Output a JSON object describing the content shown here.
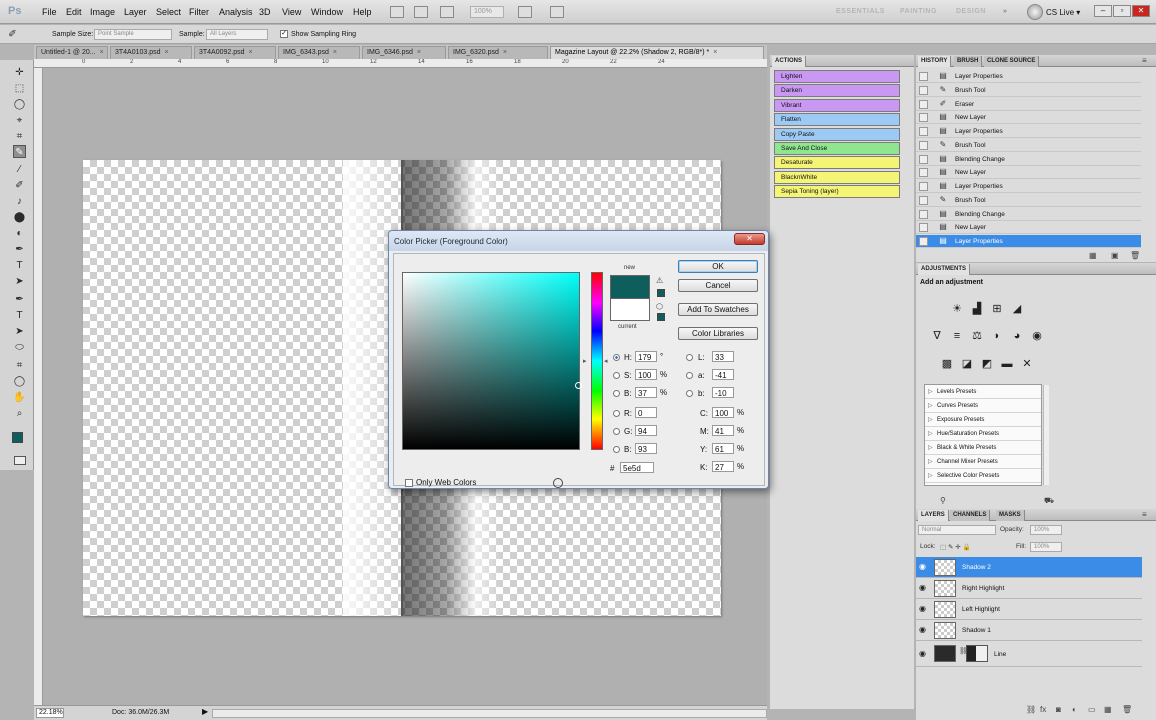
{
  "app": {
    "logo": "Ps"
  },
  "menu": [
    "File",
    "Edit",
    "Image",
    "Layer",
    "Select",
    "Filter",
    "Analysis",
    "3D",
    "View",
    "Window",
    "Help"
  ],
  "menubar_zoom": "100%",
  "workspaces": [
    "ESSENTIALS",
    "PAINTING",
    "DESIGN",
    "»"
  ],
  "cs_live": "CS Live ▾",
  "window_buttons": {
    "minimize": "–",
    "restore": "▫",
    "close": "✕"
  },
  "options": {
    "sample_size_label": "Sample Size:",
    "sample_size_value": "Point Sample",
    "sample_label": "Sample:",
    "sample_value": "All Layers",
    "show_ring_label": "Show Sampling Ring",
    "show_ring_checked": "✓"
  },
  "tabs": [
    {
      "label": "Untitled-1 @ 20..."
    },
    {
      "label": "3T4A0103.psd"
    },
    {
      "label": "3T4A0092.psd"
    },
    {
      "label": "IMG_6343.psd"
    },
    {
      "label": "IMG_6346.psd"
    },
    {
      "label": "IMG_6320.psd"
    },
    {
      "label": "Magazine Layout @ 22.2% (Shadow 2, RGB/8*) *"
    }
  ],
  "tab_close": "×",
  "ruler_numbers": [
    "0",
    "2",
    "4",
    "6",
    "8",
    "10",
    "12",
    "14",
    "16",
    "18",
    "20",
    "22",
    "24"
  ],
  "tools": [
    "✛",
    "⬚",
    "◯",
    "⌖",
    "⌗",
    "✎",
    "⁄",
    "✐",
    "♪",
    "⬤",
    "◐",
    "✒",
    "T",
    "➤",
    "⬭",
    "✋",
    "⌕"
  ],
  "status": {
    "zoom": "22.18%",
    "doc": "Doc: 36.0M/26.3M",
    "arrow": "▶"
  },
  "actions": {
    "title": "ACTIONS",
    "items": [
      {
        "label": "Lighten",
        "color": "#c898f2"
      },
      {
        "label": "Darken",
        "color": "#c898f2"
      },
      {
        "label": "Vibrant",
        "color": "#c898f2"
      },
      {
        "label": "Flatten",
        "color": "#9ccaf5"
      },
      {
        "label": "Copy Paste",
        "color": "#9ccaf5"
      },
      {
        "label": "Save And Close",
        "color": "#8fe68f"
      },
      {
        "label": "Desaturate",
        "color": "#f5f575"
      },
      {
        "label": "BlacknWhite",
        "color": "#f5f575"
      },
      {
        "label": "Sepia Toning (layer)",
        "color": "#f5f575"
      }
    ]
  },
  "history": {
    "tabs": [
      "HISTORY",
      "BRUSH",
      "CLONE SOURCE"
    ],
    "items": [
      {
        "label": "Layer Properties",
        "icon": "▤"
      },
      {
        "label": "Brush Tool",
        "icon": "✎"
      },
      {
        "label": "Eraser",
        "icon": "✐"
      },
      {
        "label": "New Layer",
        "icon": "▤"
      },
      {
        "label": "Layer Properties",
        "icon": "▤"
      },
      {
        "label": "Brush Tool",
        "icon": "✎"
      },
      {
        "label": "Blending Change",
        "icon": "▤"
      },
      {
        "label": "New Layer",
        "icon": "▤"
      },
      {
        "label": "Layer Properties",
        "icon": "▤"
      },
      {
        "label": "Brush Tool",
        "icon": "✎"
      },
      {
        "label": "Blending Change",
        "icon": "▤"
      },
      {
        "label": "New Layer",
        "icon": "▤"
      },
      {
        "label": "Layer Properties",
        "icon": "▤"
      }
    ],
    "selected_index": 12,
    "footer_icons": [
      "▦",
      "▣",
      "🗑"
    ]
  },
  "adjustments": {
    "title": "ADJUSTMENTS",
    "subtitle": "Add an adjustment",
    "icons_row1": [
      "☀",
      "▟",
      "⊞",
      "◢"
    ],
    "icons_row2": [
      "∇",
      "≡",
      "⚖",
      "◗",
      "◕",
      "◉"
    ],
    "icons_row3": [
      "▩",
      "◪",
      "◩",
      "▬",
      "✕"
    ],
    "presets": [
      "Levels Presets",
      "Curves Presets",
      "Exposure Presets",
      "Hue/Saturation Presets",
      "Black & White Presets",
      "Channel Mixer Presets",
      "Selective Color Presets"
    ],
    "footer_left": "⚲",
    "footer_right": "⛟"
  },
  "layers": {
    "tabs": [
      "LAYERS",
      "CHANNELS",
      "MASKS"
    ],
    "blend_mode": "Normal",
    "opacity_label": "Opacity:",
    "opacity_value": "100%",
    "lock_label": "Lock:",
    "lock_icons": "⬚ ✎ ✛ 🔒",
    "fill_label": "Fill:",
    "fill_value": "100%",
    "items": [
      {
        "name": "Shadow 2",
        "selected": true
      },
      {
        "name": "Right Highlight",
        "selected": false
      },
      {
        "name": "Left Highlight",
        "selected": false
      },
      {
        "name": "Shadow 1",
        "selected": false
      },
      {
        "name": "Line",
        "selected": false
      }
    ],
    "footer_icons": [
      "⛓",
      "fx",
      "◙",
      "◐",
      "▭",
      "▦",
      "🗑"
    ]
  },
  "color_picker": {
    "title": "Color Picker (Foreground Color)",
    "close": "✕",
    "new_label": "new",
    "current_label": "current",
    "new_color": "#0e5e5d",
    "current_color": "#ffffff",
    "buttons": {
      "ok": "OK",
      "cancel": "Cancel",
      "add_swatches": "Add To Swatches",
      "color_libraries": "Color Libraries"
    },
    "hsb": {
      "H": "179",
      "H_unit": "°",
      "S": "100",
      "S_unit": "%",
      "B": "37",
      "B_unit": "%"
    },
    "rgb": {
      "R": "0",
      "G": "94",
      "B": "93"
    },
    "lab": {
      "L": "33",
      "a": "-41",
      "b": "-10"
    },
    "cmyk": {
      "C": "100",
      "M": "41",
      "Y": "61",
      "K": "27",
      "unit": "%"
    },
    "hex_label": "#",
    "hex": "5e5d",
    "only_web_label": "Only Web Colors"
  }
}
